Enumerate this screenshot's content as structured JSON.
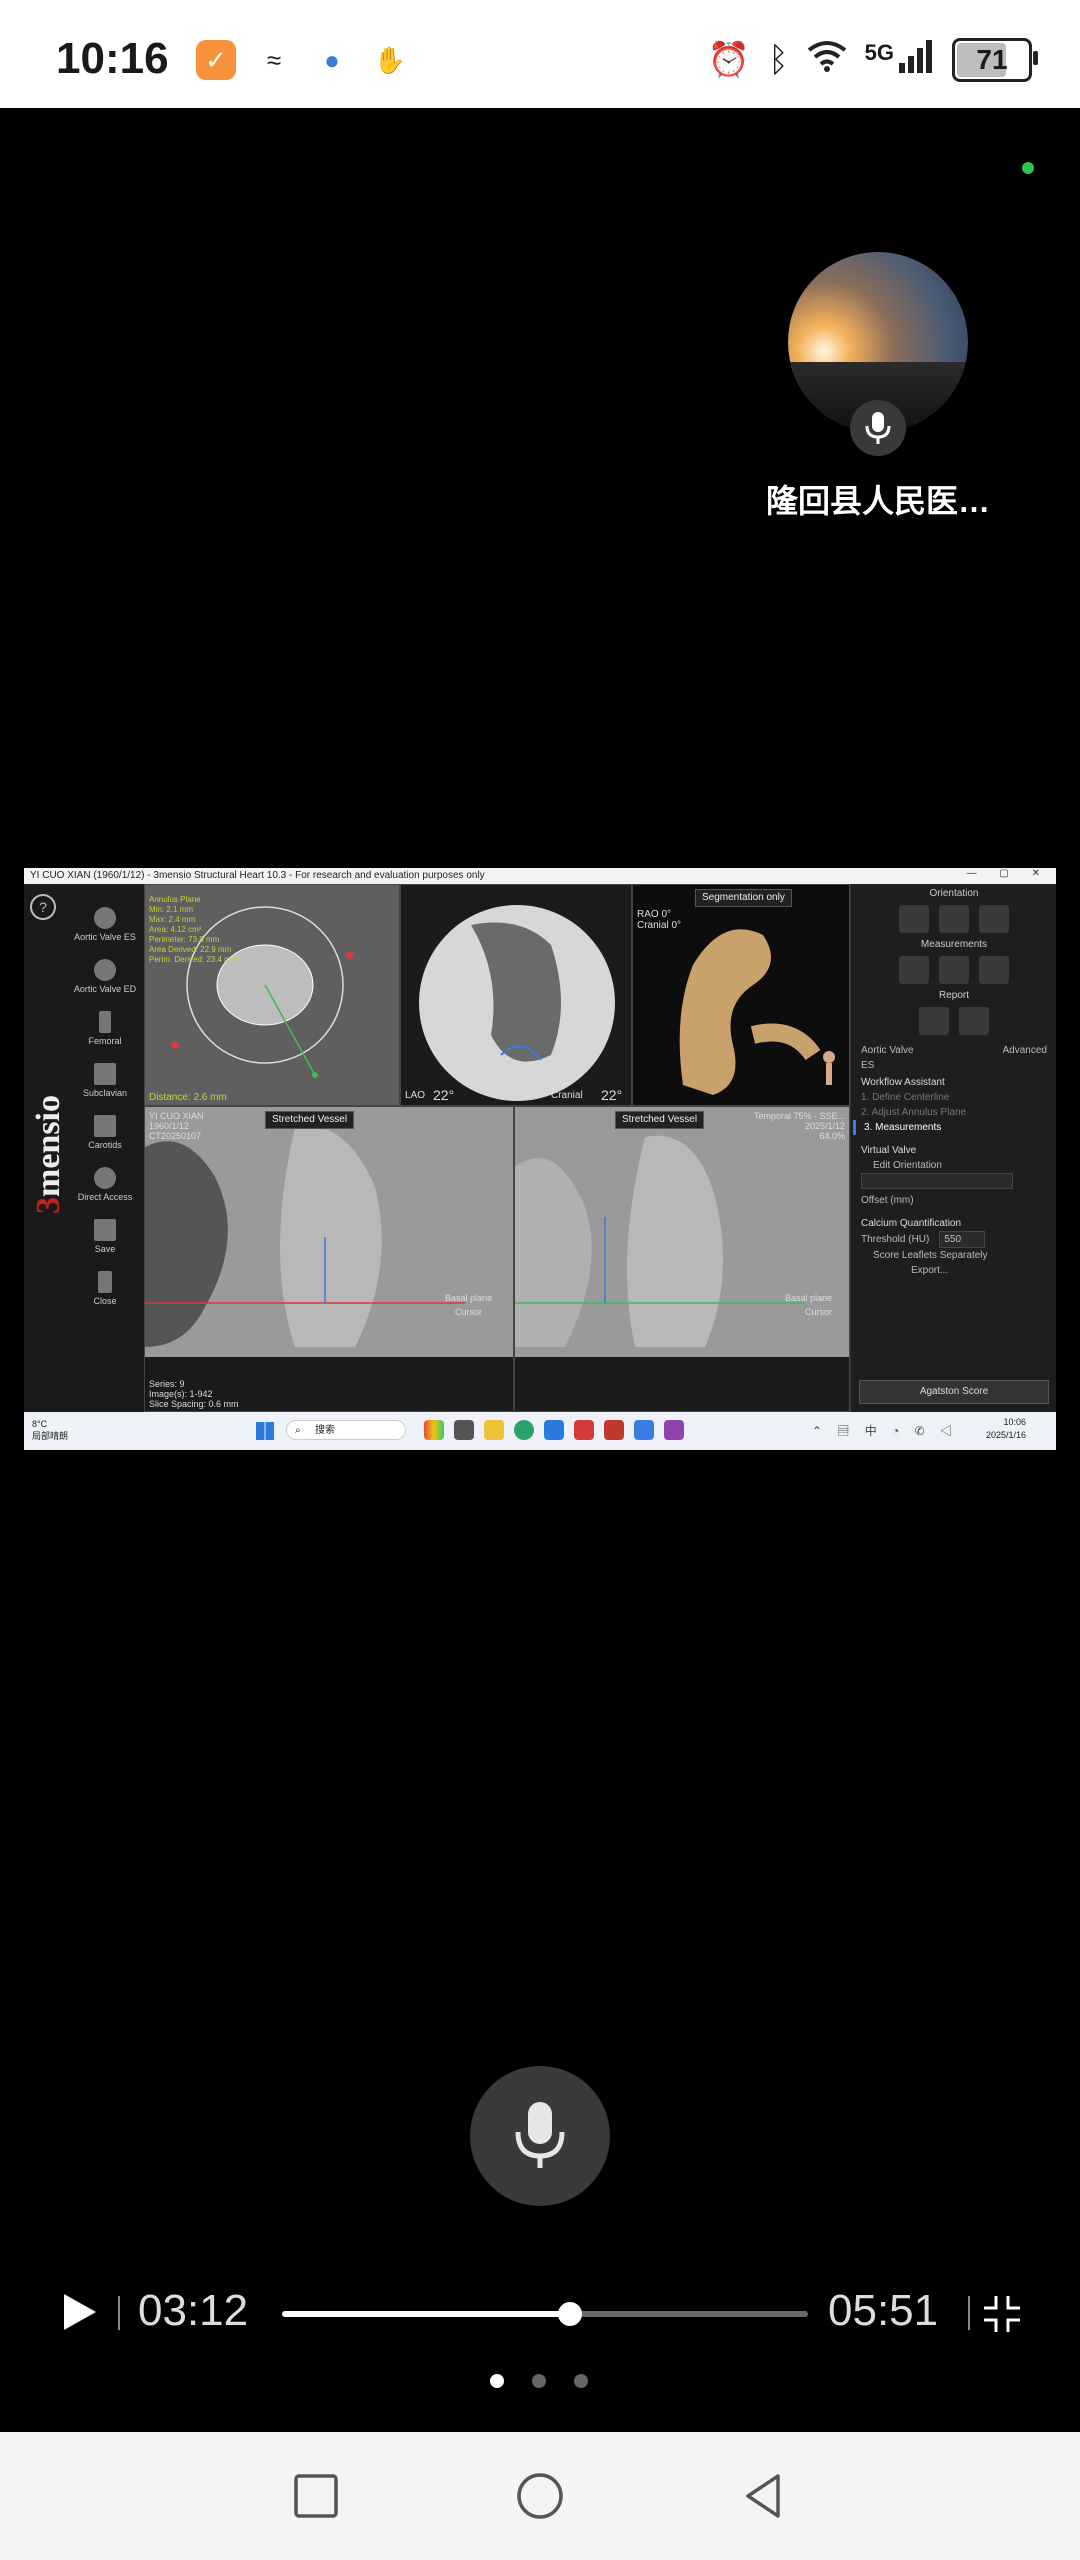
{
  "status_bar": {
    "time": "10:16",
    "battery": "71",
    "battery_level": 0.71,
    "network": "5G",
    "icons": [
      "notification-app-icon",
      "feather-app-icon",
      "blue-app-icon",
      "hand-app-icon",
      "alarm-icon",
      "bluetooth-icon",
      "wifi-icon",
      "signal-icon"
    ]
  },
  "participant": {
    "name": "隆回县人民医…",
    "online_color": "#2ec44a"
  },
  "shared_screen": {
    "app_title": "YI CUO XIAN (1960/1/12) - 3mensio Structural Heart 10.3 - For research and evaluation purposes only",
    "brand_left": "3",
    "brand_right": "mensio",
    "rail_items": [
      "Aortic Valve ES",
      "Aortic Valve ED",
      "Femoral",
      "Subclavian",
      "Carotids",
      "Direct Access",
      "Save",
      "Close"
    ],
    "viewport_tl_overlay": "Annulus Plane\nMin: 2.1 mm\nMax: 2.4 mm\nArea: 4.12 cm²\nPerimeter: 73.5 mm\nArea Derived: 22.9 mm\nPerim. Derived: 23.4 mm",
    "vp_tl_footer": "Distance: 2.6 mm",
    "vp_tc_footer_left": "LAO",
    "vp_tc_footer_angle1": "22°",
    "vp_tc_footer_mid": "Cranial",
    "vp_tc_footer_angle2": "22°",
    "vp_tr_tab": "Segmentation only",
    "vp_tr_info": "RAO 0°\nCranial 0°",
    "vp_bl_tab": "Stretched Vessel",
    "vp_bl_patient": "YI CUO XIAN\n1960/1/12\nCT20250107",
    "vp_bl_footer": "Series: 9\nImage(s): 1-942\nSlice Spacing: 0.6 mm",
    "vp_bl_labels": [
      "Basal plane",
      "Cursor"
    ],
    "vp_br_tab": "Stretched Vessel",
    "vp_br_info": "Temporal 75% - SSE...\n2025/1/12\n64.0%",
    "vp_br_labels": [
      "Basal plane",
      "Cursor"
    ],
    "right_panel": {
      "orientation": "Orientation",
      "measurements": "Measurements",
      "report": "Report",
      "valve_label": "Aortic Valve ES",
      "advanced": "Advanced",
      "workflow_title": "Workflow Assistant",
      "workflow_steps": [
        "1. Define Centerline",
        "2. Adjust Annulus Plane",
        "3. Measurements"
      ],
      "virtual_valve": "Virtual Valve",
      "edit_orientation": "Edit Orientation",
      "offset": "Offset (mm)",
      "calcium": "Calcium Quantification",
      "threshold": "Threshold (HU)",
      "threshold_value": "550",
      "score_leaflets": "Score Leaflets Separately",
      "export": "Export...",
      "agatston": "Agatston Score"
    },
    "taskbar": {
      "weather_temp": "8°C",
      "weather_desc": "局部晴朗",
      "search": "搜索",
      "clock_time": "10:06",
      "clock_date": "2025/1/16"
    }
  },
  "playback": {
    "current_time": "03:12",
    "total_time": "05:51",
    "progress_percent": 54.7
  },
  "pager": {
    "count": 3,
    "active": 0
  }
}
